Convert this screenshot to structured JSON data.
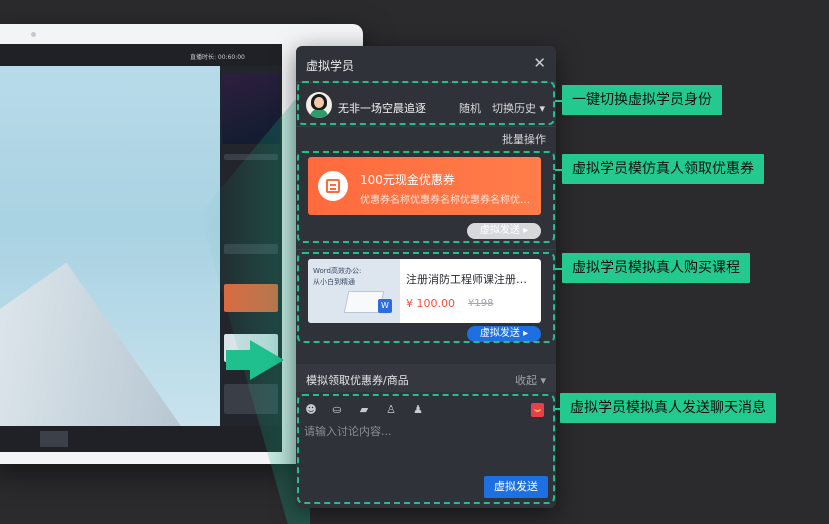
{
  "colors": {
    "background": "#2b2b2d",
    "panel": "#2f3238",
    "accent_green": "#23c98f",
    "coupon_orange": "#ff6a3d",
    "send_blue": "#1e6fe0",
    "price_red": "#ff4d3a"
  },
  "laptop": {
    "live_timer": "直播时长: 00:60:00"
  },
  "panel": {
    "title": "虚拟学员",
    "close_icon": "close-icon",
    "student": {
      "name": "无非一场空晨追逐",
      "random_label": "随机",
      "history_label": "切换历史 ▾"
    },
    "batch_label": "批量操作",
    "coupon": {
      "title": "100元现金优惠券",
      "description": "优惠券名称优惠券名称优惠券名称优惠券名称",
      "send_label": "虚拟发送 ▸"
    },
    "course": {
      "thumb_line1": "Word高效办公:",
      "thumb_line2": "从小白到精通",
      "name": "注册消防工程师课注册消防工程师课",
      "price": "¥ 100.00",
      "original_price": "¥198",
      "send_label": "虚拟发送 ▸"
    },
    "section": {
      "title": "模拟领取优惠券/商品",
      "collapse_label": "收起 ▾"
    },
    "chat": {
      "placeholder": "请输入讨论内容...",
      "send_label": "虚拟发送",
      "toolbar_icons": [
        "emoji-icon",
        "vip-icon",
        "folder-icon",
        "student-icon",
        "group-icon",
        "red-packet-icon"
      ]
    }
  },
  "callouts": [
    "一键切换虚拟学员身份",
    "虚拟学员模仿真人领取优惠券",
    "虚拟学员模拟真人购买课程",
    "虚拟学员模拟真人发送聊天消息"
  ]
}
